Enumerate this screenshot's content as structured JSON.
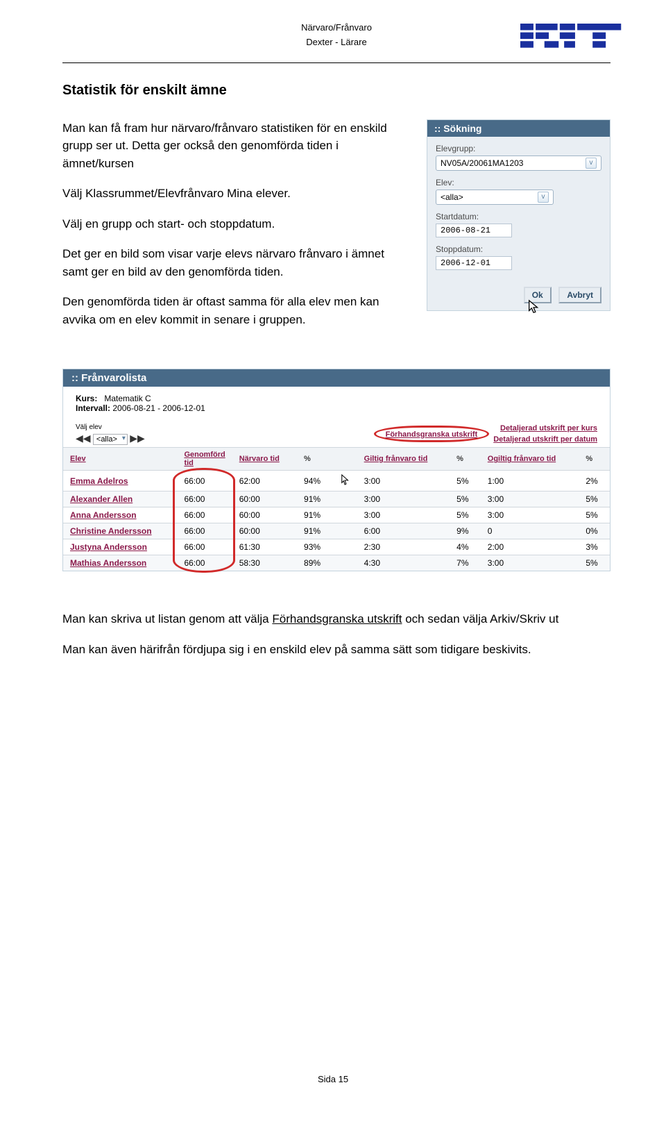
{
  "header": {
    "line1": "Närvaro/Frånvaro",
    "line2": "Dexter - Lärare"
  },
  "section_title": "Statistik för enskilt ämne",
  "paras": {
    "p1": "Man kan få fram hur närvaro/frånvaro statistiken för en enskild grupp ser ut. Detta ger också den genomförda tiden i ämnet/kursen",
    "p2": "Välj Klassrummet/Elevfrånvaro Mina elever.",
    "p3": "Välj en grupp och start- och stoppdatum.",
    "p4": "Det ger en bild som visar varje elevs närvaro frånvaro i ämnet samt ger en bild av den genomförda tiden.",
    "p5": "Den genomförda tiden är oftast samma för alla elev men kan avvika om en elev kommit in senare i gruppen."
  },
  "sokning": {
    "title": ":: Sökning",
    "elevgrupp_label": "Elevgrupp:",
    "elevgrupp_value": "NV05A/20061MA1203",
    "elev_label": "Elev:",
    "elev_value": "<alla>",
    "start_label": "Startdatum:",
    "start_value": "2006-08-21",
    "stopp_label": "Stoppdatum:",
    "stopp_value": "2006-12-01",
    "ok": "Ok",
    "cancel": "Avbryt"
  },
  "flista": {
    "title": ":: Frånvarolista",
    "kurs_label": "Kurs:",
    "kurs_value": "Matematik C",
    "intervall_label": "Intervall:",
    "intervall_value": "2006-08-21 - 2006-12-01",
    "valj_elev": "Välj elev",
    "valj_elev_value": "<alla>",
    "preview": "Förhandsgranska utskrift",
    "det_kurs": "Detaljerad utskrift per kurs",
    "det_datum": "Detaljerad utskrift per datum",
    "headers": {
      "elev": "Elev",
      "genomford": "Genomförd tid",
      "narvaro": "Närvaro tid",
      "pct1": "%",
      "giltig": "Giltig frånvaro tid",
      "pct2": "%",
      "ogiltig": "Ogiltig frånvaro tid",
      "pct3": "%"
    },
    "rows": [
      {
        "name": "Emma Adelros",
        "g": "66:00",
        "n": "62:00",
        "np": "94%",
        "gf": "3:00",
        "gfp": "5%",
        "of": "1:00",
        "ofp": "2%"
      },
      {
        "name": "Alexander Allen",
        "g": "66:00",
        "n": "60:00",
        "np": "91%",
        "gf": "3:00",
        "gfp": "5%",
        "of": "3:00",
        "ofp": "5%"
      },
      {
        "name": "Anna Andersson",
        "g": "66:00",
        "n": "60:00",
        "np": "91%",
        "gf": "3:00",
        "gfp": "5%",
        "of": "3:00",
        "ofp": "5%"
      },
      {
        "name": "Christine Andersson",
        "g": "66:00",
        "n": "60:00",
        "np": "91%",
        "gf": "6:00",
        "gfp": "9%",
        "of": "0",
        "ofp": "0%"
      },
      {
        "name": "Justyna Andersson",
        "g": "66:00",
        "n": "61:30",
        "np": "93%",
        "gf": "2:30",
        "gfp": "4%",
        "of": "2:00",
        "ofp": "3%"
      },
      {
        "name": "Mathias Andersson",
        "g": "66:00",
        "n": "58:30",
        "np": "89%",
        "gf": "4:30",
        "gfp": "7%",
        "of": "3:00",
        "ofp": "5%"
      }
    ]
  },
  "bottom": {
    "p1a": "Man kan skriva ut listan genom att välja ",
    "p1b": "Förhandsgranska utskrift",
    "p1c": " och sedan välja Arkiv/Skriv ut",
    "p2": "Man kan även härifrån fördjupa sig i en enskild elev på samma sätt som tidigare beskivits."
  },
  "footer": "Sida 15"
}
